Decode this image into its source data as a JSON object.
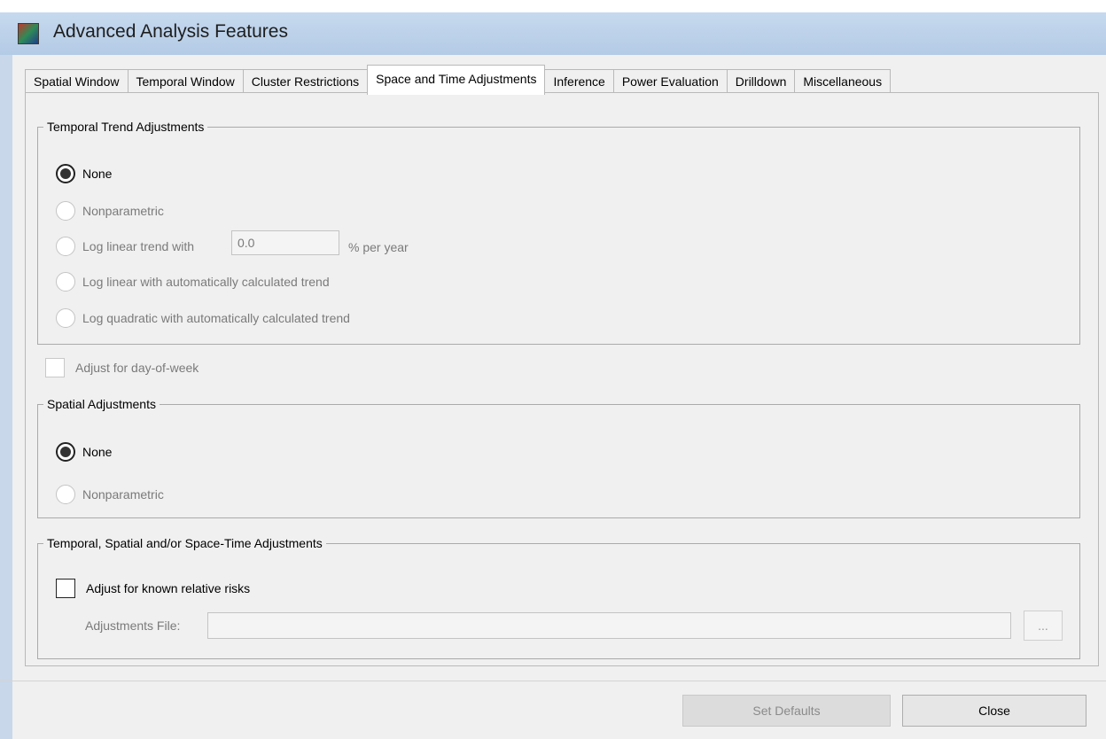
{
  "window": {
    "title": "Advanced Analysis Features",
    "icon": "app-globe-icon"
  },
  "tabs": [
    {
      "label": "Spatial Window"
    },
    {
      "label": "Temporal Window"
    },
    {
      "label": "Cluster Restrictions"
    },
    {
      "label": "Space and Time Adjustments",
      "active": true
    },
    {
      "label": "Inference"
    },
    {
      "label": "Power Evaluation"
    },
    {
      "label": "Drilldown"
    },
    {
      "label": "Miscellaneous"
    }
  ],
  "temporal_trend": {
    "legend": "Temporal Trend Adjustments",
    "options": [
      {
        "label": "None",
        "selected": true
      },
      {
        "label": "Nonparametric"
      },
      {
        "label": "Log linear trend with"
      },
      {
        "label": "Log linear with automatically calculated trend"
      },
      {
        "label": "Log quadratic with automatically calculated trend"
      }
    ],
    "log_linear_value": "0.0",
    "log_linear_unit": "% per year"
  },
  "day_of_week": {
    "label": "Adjust for day-of-week",
    "checked": false
  },
  "spatial": {
    "legend": "Spatial Adjustments",
    "options": [
      {
        "label": "None",
        "selected": true
      },
      {
        "label": "Nonparametric"
      }
    ]
  },
  "space_time": {
    "legend": "Temporal, Spatial and/or Space-Time Adjustments",
    "relative_risks_label": "Adjust for known relative risks",
    "relative_risks_checked": false,
    "file_label": "Adjustments File:",
    "file_value": "",
    "browse_label": "..."
  },
  "footer": {
    "set_defaults_label": "Set Defaults",
    "close_label": "Close"
  },
  "colors": {
    "titlebar": "#b9cfe8",
    "panel": "#f0f0f0",
    "active_tab": "#ffffff"
  }
}
